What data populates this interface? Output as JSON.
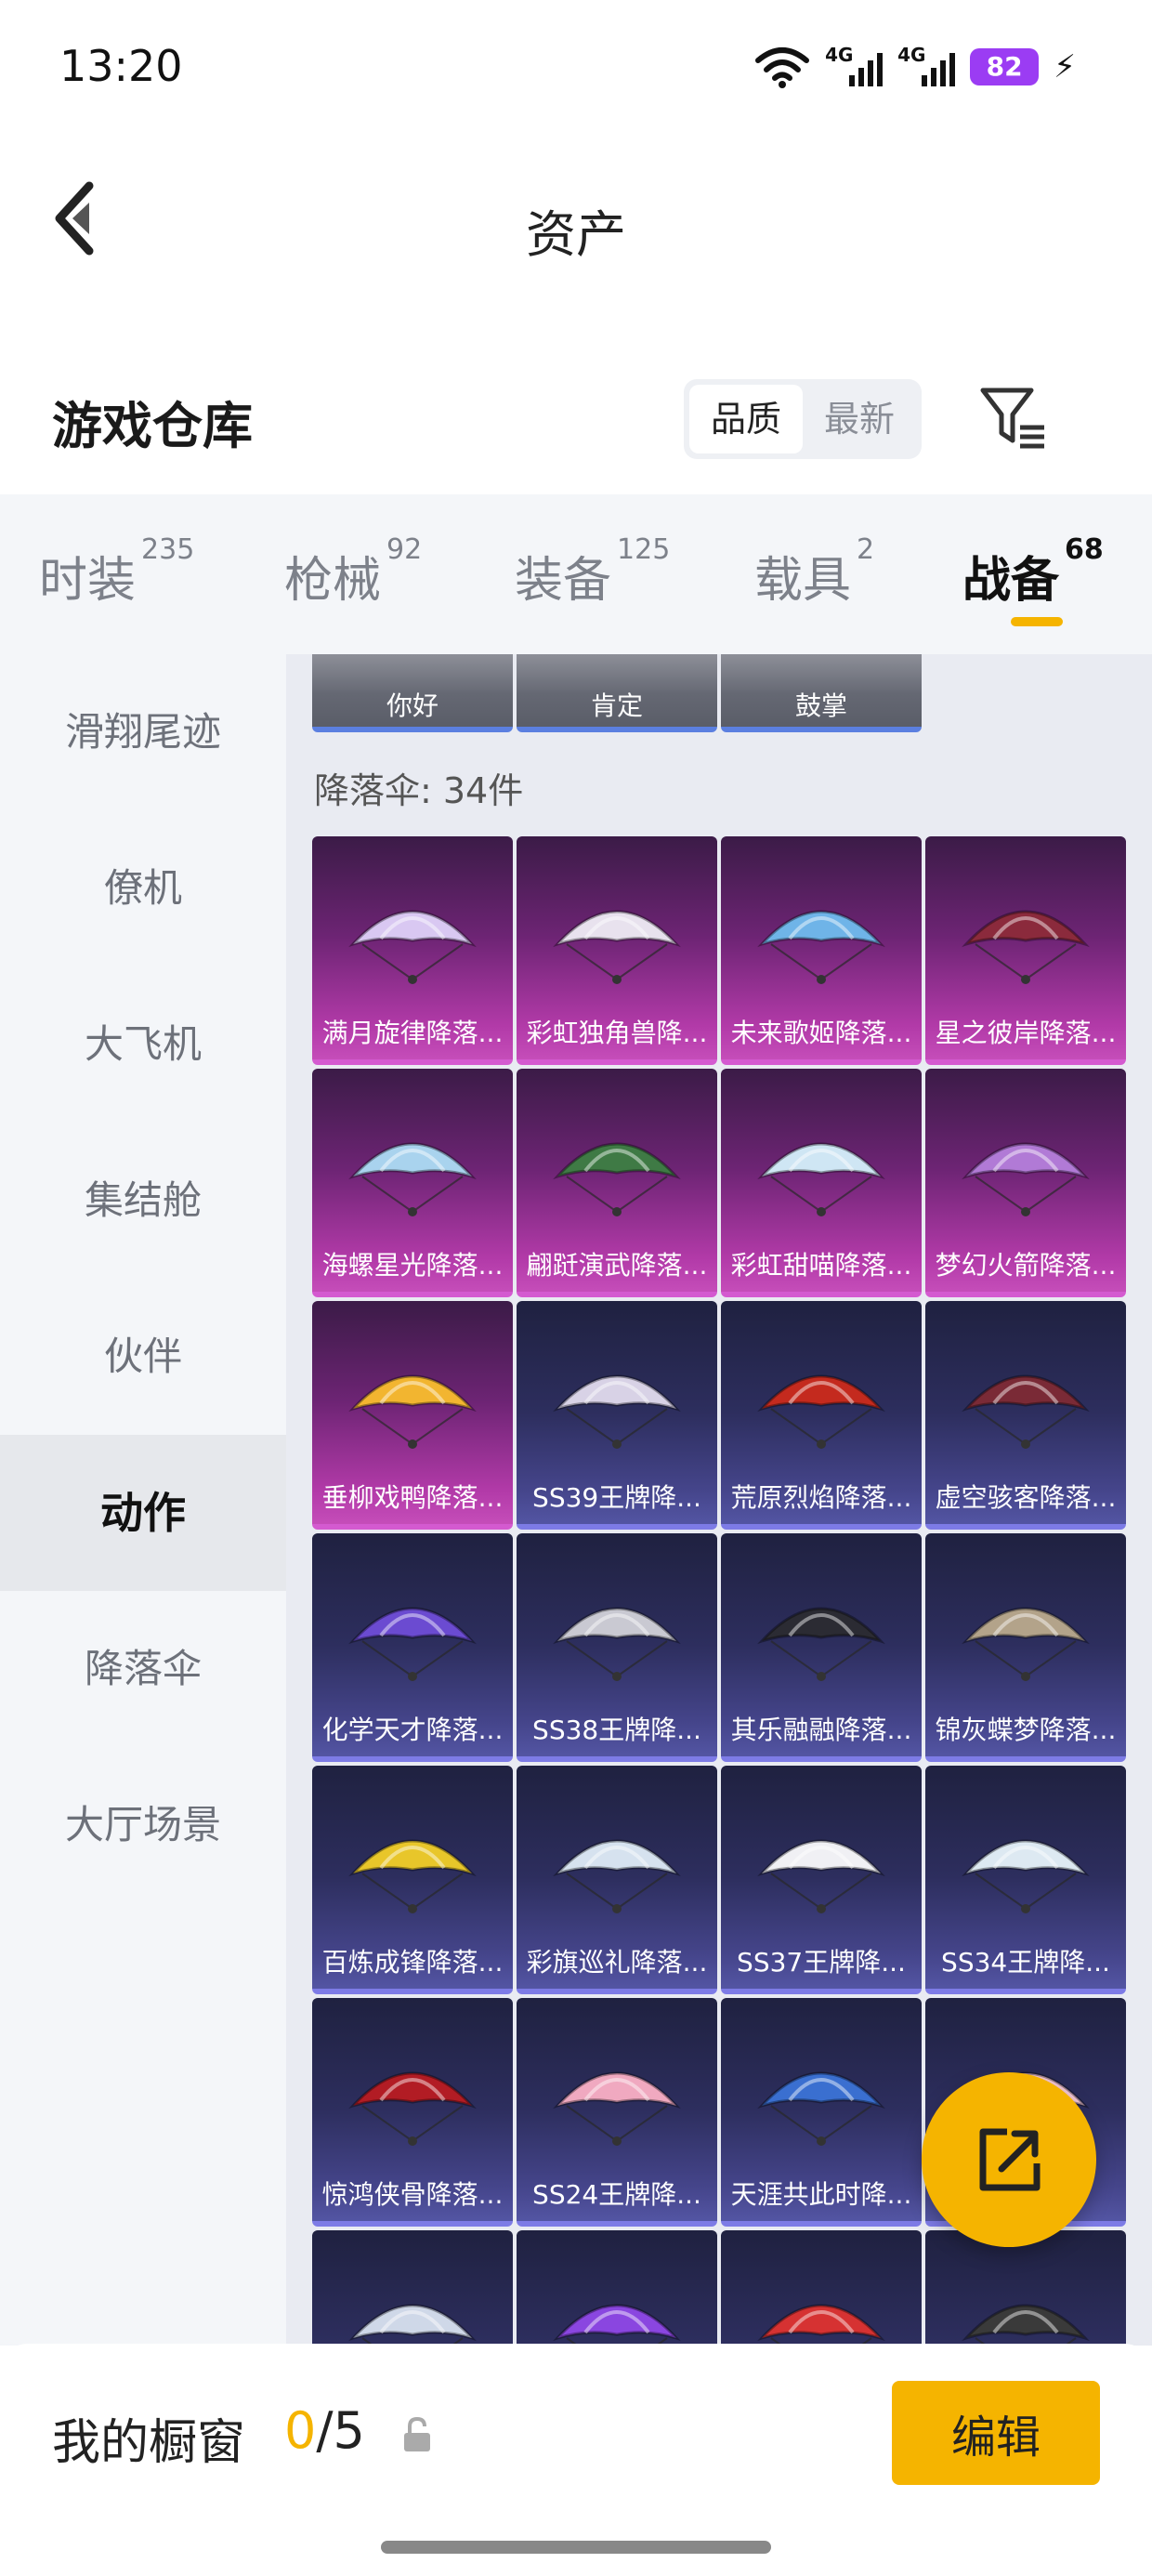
{
  "status_bar": {
    "time": "13:20",
    "network_1": "4G",
    "network_2": "4G",
    "battery": "82"
  },
  "nav": {
    "title": "资产"
  },
  "header": {
    "title": "游戏仓库",
    "sort_options": [
      "品质",
      "最新"
    ],
    "sort_selected": "品质"
  },
  "tabs": [
    {
      "label": "时装",
      "count": "235"
    },
    {
      "label": "枪械",
      "count": "92"
    },
    {
      "label": "装备",
      "count": "125"
    },
    {
      "label": "载具",
      "count": "2"
    },
    {
      "label": "战备",
      "count": "68"
    }
  ],
  "active_tab": "战备",
  "sidebar": {
    "items": [
      "滑翔尾迹",
      "僚机",
      "大飞机",
      "集结舱",
      "伙伴",
      "动作",
      "降落伞",
      "大厅场景"
    ],
    "active": "动作"
  },
  "content": {
    "previous_items": [
      "你好",
      "肯定",
      "鼓掌"
    ],
    "section_count": "降落伞: 34件",
    "items": [
      {
        "name": "满月旋律降落...",
        "rarity": "pink"
      },
      {
        "name": "彩虹独角兽降...",
        "rarity": "pink"
      },
      {
        "name": "未来歌姬降落...",
        "rarity": "pink"
      },
      {
        "name": "星之彼岸降落...",
        "rarity": "pink"
      },
      {
        "name": "海螺星光降落...",
        "rarity": "pink"
      },
      {
        "name": "翩跹演武降落...",
        "rarity": "pink"
      },
      {
        "name": "彩虹甜喵降落...",
        "rarity": "pink"
      },
      {
        "name": "梦幻火箭降落...",
        "rarity": "pink"
      },
      {
        "name": "垂柳戏鸭降落...",
        "rarity": "pink"
      },
      {
        "name": "SS39王牌降...",
        "rarity": "blue"
      },
      {
        "name": "荒原烈焰降落...",
        "rarity": "blue"
      },
      {
        "name": "虚空骇客降落...",
        "rarity": "blue"
      },
      {
        "name": "化学天才降落...",
        "rarity": "blue"
      },
      {
        "name": "SS38王牌降...",
        "rarity": "blue"
      },
      {
        "name": "其乐融融降落...",
        "rarity": "blue"
      },
      {
        "name": "锦灰蝶梦降落...",
        "rarity": "blue"
      },
      {
        "name": "百炼成锋降落...",
        "rarity": "blue"
      },
      {
        "name": "彩旗巡礼降落...",
        "rarity": "blue"
      },
      {
        "name": "SS37王牌降...",
        "rarity": "blue"
      },
      {
        "name": "SS34王牌降...",
        "rarity": "blue"
      },
      {
        "name": "惊鸿侠骨降落...",
        "rarity": "blue"
      },
      {
        "name": "SS24王牌降...",
        "rarity": "blue"
      },
      {
        "name": "天涯共此时降...",
        "rarity": "blue"
      },
      {
        "name": "",
        "rarity": "blue"
      },
      {
        "name": "",
        "rarity": "blue"
      },
      {
        "name": "",
        "rarity": "blue"
      },
      {
        "name": "",
        "rarity": "blue"
      },
      {
        "name": "",
        "rarity": "blue"
      }
    ]
  },
  "bottom": {
    "showcase_label": "我的橱窗",
    "showcase_used": "0",
    "showcase_total": "/5",
    "edit_label": "编辑"
  },
  "colors": {
    "accent": "#f5b400",
    "epic_card": "#b23aa8",
    "rare_card": "#45458b",
    "battery": "#9b3cf3"
  },
  "icons": [
    "wifi-icon",
    "signal-icon",
    "battery-icon",
    "charging-icon",
    "back-icon",
    "filter-icon",
    "lock-icon",
    "share-icon"
  ]
}
